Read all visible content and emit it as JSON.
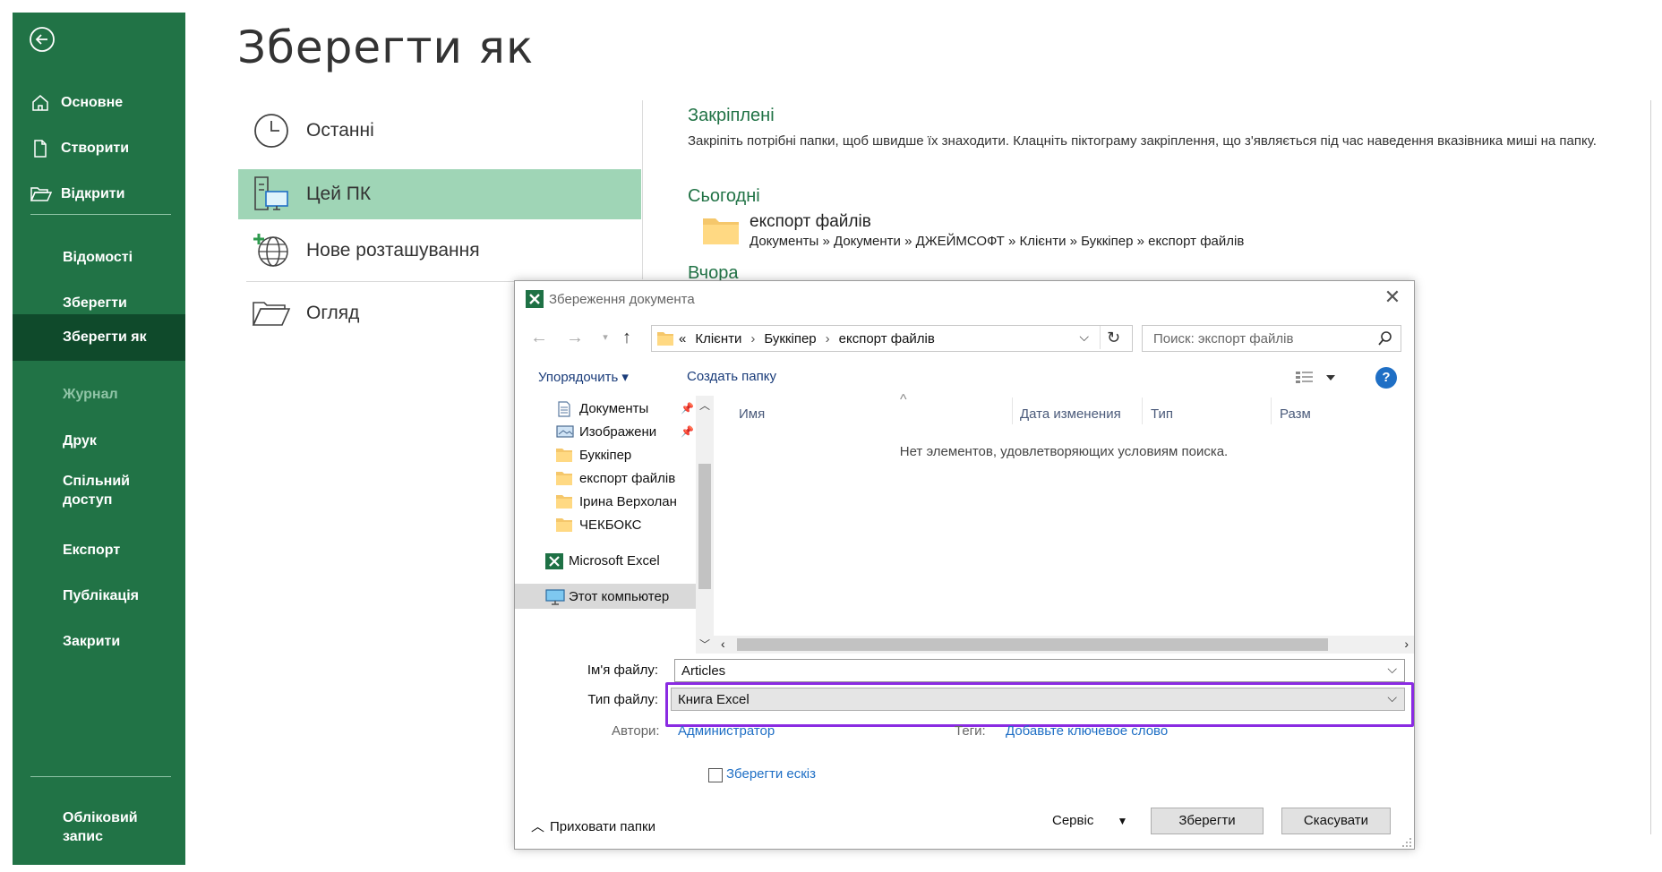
{
  "backstage": {
    "nav": {
      "home": "Основне",
      "new": "Створити",
      "open": "Відкрити",
      "info": "Відомості",
      "save": "Зберегти",
      "save_as": "Зберегти як",
      "history": "Журнал",
      "print": "Друк",
      "share": "Спільний доступ",
      "export": "Експорт",
      "publish": "Публікація",
      "close": "Закрити",
      "account": "Обліковий запис"
    },
    "title": "Зберегти як",
    "locations": {
      "recent": "Останні",
      "this_pc": "Цей ПК",
      "add_place": "Нове розташування",
      "browse": "Огляд"
    },
    "pinned_heading": "Закріплені",
    "pinned_desc": "Закріпіть потрібні папки, щоб швидше їх знаходити. Клацніть піктограму закріплення, що з'являється під час наведення вказівника миші на папку.",
    "today_heading": "Сьогодні",
    "recent_folder": {
      "name": "експорт файлів",
      "path": "Документы » Документи » ДЖЕЙМСОФТ » Клієнти » Буккіпер » експорт файлів"
    },
    "yesterday_heading": "Вчора"
  },
  "dialog": {
    "title": "Збереження документа",
    "address": {
      "prefix": "«",
      "crumbs": [
        "Клієнти",
        "Буккіпер",
        "експорт файлів"
      ]
    },
    "search_placeholder": "Поиск: экспорт файлів",
    "toolbar": {
      "organize": "Упорядочить ▾",
      "new_folder": "Создать папку"
    },
    "tree": [
      {
        "label": "Документы",
        "icon": "documents-icon",
        "pinned": true
      },
      {
        "label": "Изображени",
        "icon": "pictures-icon",
        "pinned": true
      },
      {
        "label": "Буккіпер",
        "icon": "folder-icon"
      },
      {
        "label": "експорт файлів",
        "icon": "folder-icon"
      },
      {
        "label": "Ірина Верхолан",
        "icon": "folder-icon"
      },
      {
        "label": "ЧЕКБОКС",
        "icon": "folder-icon"
      },
      {
        "label": "Microsoft Excel",
        "icon": "excel-icon"
      },
      {
        "label": "Этот компьютер",
        "icon": "computer-icon"
      }
    ],
    "columns": [
      "Имя",
      "Дата изменения",
      "Тип",
      "Разм"
    ],
    "empty_message": "Нет элементов, удовлетворяющих условиям поиска.",
    "filename_label": "Ім'я файлу:",
    "filename_value": "Articles",
    "filetype_label": "Тип файлу:",
    "filetype_value": "Книга Excel",
    "authors_label": "Автори:",
    "authors_value": "Администратор",
    "tags_label": "Теги:",
    "tags_value": "Добавьте ключевое слово",
    "thumbnail_label": "Зберегти ескіз",
    "hide_folders": "Приховати папки",
    "service": "Сервіс",
    "save_button": "Зберегти",
    "cancel_button": "Скасувати"
  },
  "colors": {
    "sidebar": "#217346",
    "sidebar_active": "#0f4a2b",
    "location_active": "#9fd5b6",
    "highlight": "#8a2be2",
    "link": "#1f6fc5"
  }
}
